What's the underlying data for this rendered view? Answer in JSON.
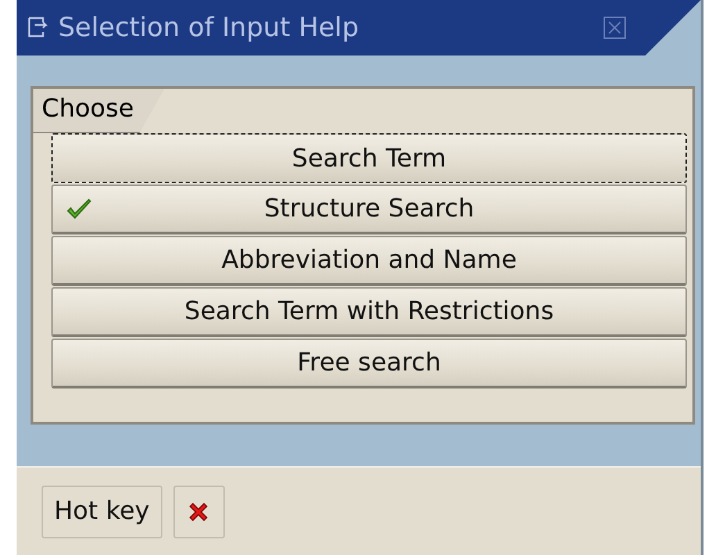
{
  "window": {
    "title": "Selection of Input Help"
  },
  "tab": {
    "label": "Choose"
  },
  "options": [
    {
      "label": "Search Term",
      "focused": true,
      "checked": false
    },
    {
      "label": "Structure Search",
      "focused": false,
      "checked": true
    },
    {
      "label": "Abbreviation and Name",
      "focused": false,
      "checked": false
    },
    {
      "label": "Search Term with Restrictions",
      "focused": false,
      "checked": false
    },
    {
      "label": "Free search",
      "focused": false,
      "checked": false
    }
  ],
  "footer": {
    "hotkey_button": "Hot key"
  }
}
